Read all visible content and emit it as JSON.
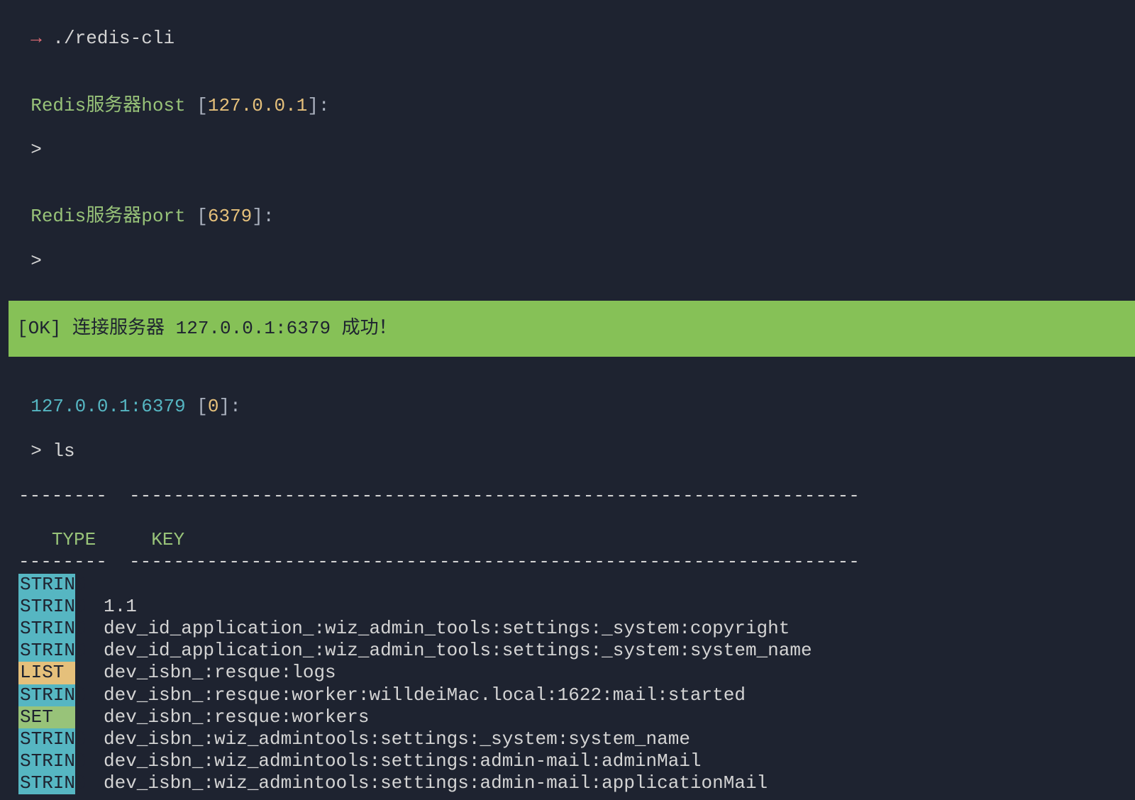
{
  "prompt": {
    "arrow": "→",
    "command": " ./redis-cli"
  },
  "host_prompt": {
    "label": "Redis服务器host",
    "bracket_open": " [",
    "value": "127.0.0.1",
    "bracket_close": "]:"
  },
  "input_caret": ">",
  "port_prompt": {
    "label": "Redis服务器port",
    "bracket_open": " [",
    "value": "6379",
    "bracket_close": "]:"
  },
  "success_message": "[OK] 连接服务器 127.0.0.1:6379 成功！",
  "cli_prompt": {
    "host": "127.0.0.1:6379",
    "bracket_open": " [",
    "db": "0",
    "bracket_close": "]:"
  },
  "ls_command": "> ls",
  "table": {
    "divider": "--------  ------------------------------------------------------------------",
    "header_type": " TYPE",
    "header_key": "     KEY",
    "rows": [
      {
        "type": "STRING",
        "type_class": "type-string",
        "key": "",
        "highlight": true
      },
      {
        "type": "STRING",
        "type_class": "type-string",
        "key": "1.1"
      },
      {
        "type": "STRING",
        "type_class": "type-string",
        "key": "dev_id_application_:wiz_admin_tools:settings:_system:copyright"
      },
      {
        "type": "STRING",
        "type_class": "type-string",
        "key": "dev_id_application_:wiz_admin_tools:settings:_system:system_name"
      },
      {
        "type": "LIST",
        "type_class": "type-list",
        "key": "dev_isbn_:resque:logs"
      },
      {
        "type": "STRING",
        "type_class": "type-string",
        "key": "dev_isbn_:resque:worker:willdeiMac.local:1622:mail:started"
      },
      {
        "type": "SET",
        "type_class": "type-set",
        "key": "dev_isbn_:resque:workers"
      },
      {
        "type": "STRING",
        "type_class": "type-string",
        "key": "dev_isbn_:wiz_admintools:settings:_system:system_name"
      },
      {
        "type": "STRING",
        "type_class": "type-string",
        "key": "dev_isbn_:wiz_admintools:settings:admin-mail:adminMail"
      },
      {
        "type": "STRING",
        "type_class": "type-string",
        "key": "dev_isbn_:wiz_admintools:settings:admin-mail:applicationMail"
      }
    ]
  }
}
